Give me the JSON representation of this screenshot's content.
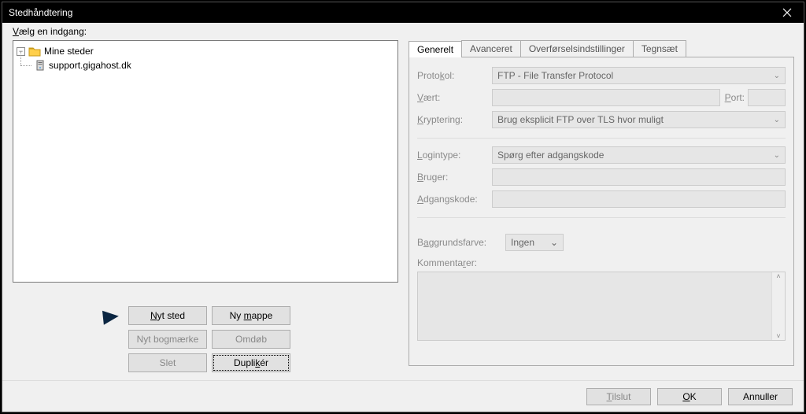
{
  "window": {
    "title": "Stedhåndtering"
  },
  "left": {
    "label": "Vælg en indgang:",
    "root_label": "Mine steder",
    "site_label": "support.gigahost.dk"
  },
  "buttons": {
    "new_site": "Nyt sted",
    "new_folder": "Ny mappe",
    "bookmark": "Nyt bogmærke",
    "rename": "Omdøb",
    "delete": "Slet",
    "duplicate": "Duplikér"
  },
  "tabs": {
    "general": "Generelt",
    "advanced": "Avanceret",
    "transfer": "Overførselsindstillinger",
    "charset": "Tegnsæt"
  },
  "form": {
    "protocol_lbl": "Protokol:",
    "protocol_val": "FTP - File Transfer Protocol",
    "host_lbl": "Vært:",
    "port_lbl": "Port:",
    "encrypt_lbl": "Kryptering:",
    "encrypt_val": "Brug eksplicit FTP over TLS hvor muligt",
    "logintype_lbl": "Logintype:",
    "logintype_val": "Spørg efter adgangskode",
    "user_lbl": "Bruger:",
    "password_lbl": "Adgangskode:",
    "bgcolor_lbl": "Baggrundsfarve:",
    "bgcolor_val": "Ingen",
    "comment_lbl": "Kommentarer:"
  },
  "footer": {
    "connect": "Tilslut",
    "ok": "OK",
    "cancel": "Annuller"
  }
}
